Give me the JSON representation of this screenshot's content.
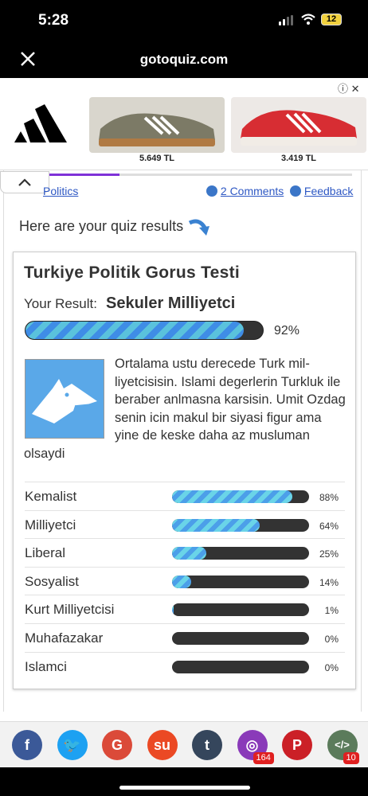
{
  "status_bar": {
    "time": "5:28",
    "battery": "12"
  },
  "browser": {
    "domain": "gotoquiz.com"
  },
  "ad": {
    "brand_icon": "adidas-logo",
    "products": [
      {
        "price": "5.649 TL",
        "color": "#7c7a66"
      },
      {
        "price": "3.419 TL",
        "color": "#d72d33"
      }
    ]
  },
  "nav": {
    "category": "Politics",
    "comments": "2 Comments",
    "feedback": "Feedback"
  },
  "intro": "Here are your quiz results",
  "quiz": {
    "title": "Turkiye Politik Gorus Testi",
    "result_label": "Your Result:",
    "result_value": "Sekuler Milliyetci",
    "result_percent_text": "92%",
    "result_percent": 92,
    "description": "Ortalama ustu derecede Turk mil-liyetcisisin. Islami degerlerin Turkluk ile beraber anlmasna karsisin. Umit Ozdag senin icin makul bir siyasi figur ama yine de keske daha az musluman olsaydi",
    "rows": [
      {
        "name": "Kemalist",
        "percent_text": "88%",
        "percent": 88
      },
      {
        "name": "Milliyetci",
        "percent_text": "64%",
        "percent": 64
      },
      {
        "name": "Liberal",
        "percent_text": "25%",
        "percent": 25
      },
      {
        "name": "Sosyalist",
        "percent_text": "14%",
        "percent": 14
      },
      {
        "name": "Kurt Milliyetcisi",
        "percent_text": "1%",
        "percent": 1
      },
      {
        "name": "Muhafazakar",
        "percent_text": "0%",
        "percent": 0
      },
      {
        "name": "Islamci",
        "percent_text": "0%",
        "percent": 0
      }
    ]
  },
  "share": {
    "buttons": [
      {
        "name": "facebook",
        "glyph": "f",
        "color": "#3b5998"
      },
      {
        "name": "twitter",
        "glyph": "🐦",
        "color": "#1da1f2"
      },
      {
        "name": "google",
        "glyph": "G",
        "color": "#db4a39"
      },
      {
        "name": "stumbleupon",
        "glyph": "su",
        "color": "#eb4924"
      },
      {
        "name": "tumblr",
        "glyph": "t",
        "color": "#35465c"
      },
      {
        "name": "instagram",
        "glyph": "◎",
        "color": "#8a3ab9",
        "count": "164"
      },
      {
        "name": "pinterest",
        "glyph": "P",
        "color": "#cb2027"
      },
      {
        "name": "embed",
        "glyph": "</>",
        "color": "#5b7b5b",
        "count": "10"
      }
    ]
  }
}
